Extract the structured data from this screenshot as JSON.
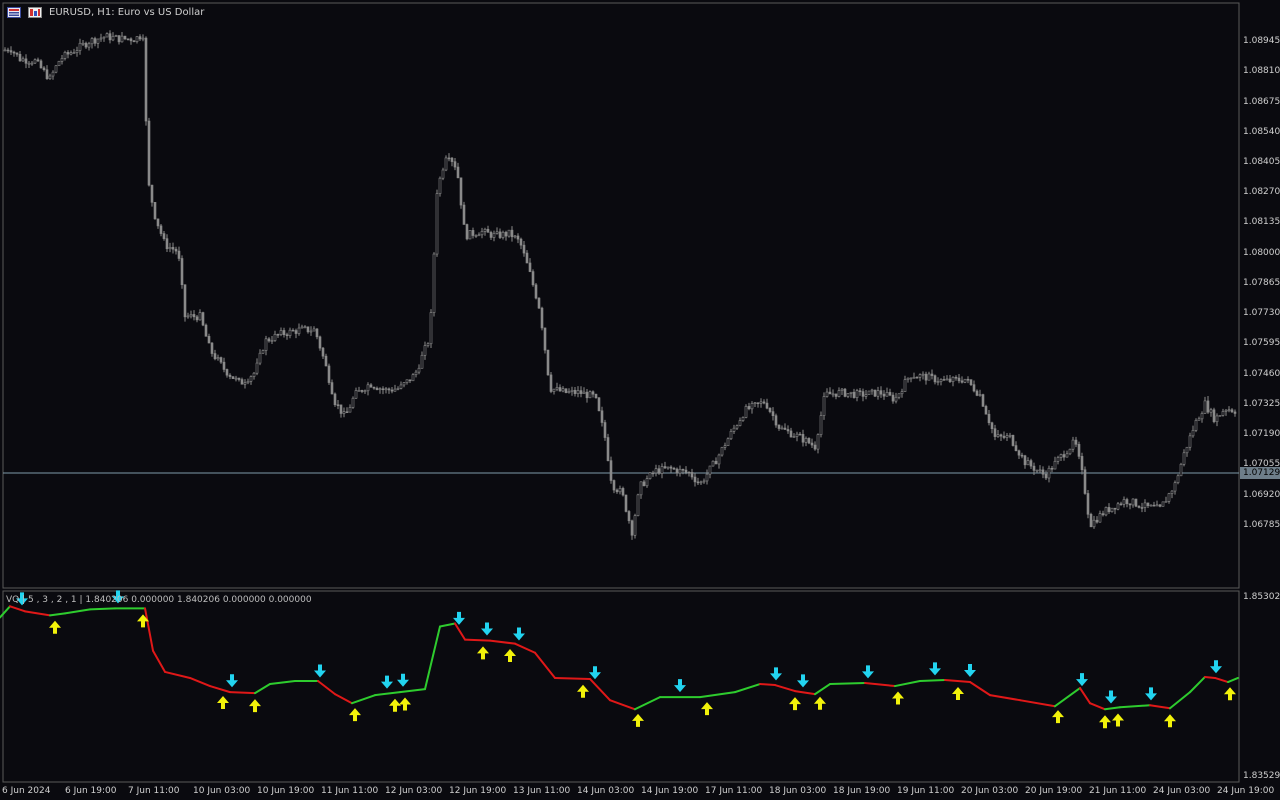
{
  "header": {
    "symbol_title": "EURUSD, H1:  Euro vs US Dollar",
    "icon_1": "chart-grid-icon",
    "icon_2": "bars-icon"
  },
  "indicator": {
    "label": "VQ | 5 , 3 , 2 , 1  |  1.840206 0.000000 1.840206 0.000000 0.000000",
    "scale_top": "1.853022",
    "scale_bottom": "1.835290"
  },
  "price_axis": {
    "labels": [
      "1.08945",
      "1.08810",
      "1.08675",
      "1.08540",
      "1.08405",
      "1.08270",
      "1.08135",
      "1.08000",
      "1.07865",
      "1.07730",
      "1.07595",
      "1.07460",
      "1.07325",
      "1.07190",
      "1.07055",
      "1.06920",
      "1.06785"
    ],
    "current_price": "1.07129"
  },
  "time_axis": {
    "labels": [
      "6 Jun 2024",
      "6 Jun 19:00",
      "7 Jun 11:00",
      "10 Jun 03:00",
      "10 Jun 19:00",
      "11 Jun 11:00",
      "12 Jun 03:00",
      "12 Jun 19:00",
      "13 Jun 11:00",
      "14 Jun 03:00",
      "14 Jun 19:00",
      "17 Jun 11:00",
      "18 Jun 03:00",
      "18 Jun 19:00",
      "19 Jun 11:00",
      "20 Jun 03:00",
      "20 Jun 19:00",
      "21 Jun 11:00",
      "24 Jun 03:00",
      "24 Jun 19:00"
    ]
  },
  "colors": {
    "background": "#0a0a0f",
    "candle": "#8a8a8a",
    "border": "#5a5a5a",
    "current_line": "#7f9aa8",
    "line_up": "#2ecc2e",
    "line_down": "#e01818",
    "arrow_up": "#f2f20a",
    "arrow_down": "#22d4f0"
  },
  "chart_data": {
    "type": "candlestick",
    "symbol": "EURUSD",
    "timeframe": "H1",
    "ylim": [
      1.0665,
      1.0899
    ],
    "current_price": 1.07129,
    "close_path": [
      {
        "x": 0,
        "y": 1.089
      },
      {
        "x": 10,
        "y": 1.0892
      },
      {
        "x": 20,
        "y": 1.0887
      },
      {
        "x": 35,
        "y": 1.0886
      },
      {
        "x": 50,
        "y": 1.0878
      },
      {
        "x": 60,
        "y": 1.0887
      },
      {
        "x": 75,
        "y": 1.0891
      },
      {
        "x": 90,
        "y": 1.0895
      },
      {
        "x": 105,
        "y": 1.0897
      },
      {
        "x": 120,
        "y": 1.0896
      },
      {
        "x": 135,
        "y": 1.0896
      },
      {
        "x": 143,
        "y": 1.0898
      },
      {
        "x": 148,
        "y": 1.0832
      },
      {
        "x": 155,
        "y": 1.0817
      },
      {
        "x": 165,
        "y": 1.0804
      },
      {
        "x": 178,
        "y": 1.0801
      },
      {
        "x": 185,
        "y": 1.0772
      },
      {
        "x": 200,
        "y": 1.0772
      },
      {
        "x": 210,
        "y": 1.0757
      },
      {
        "x": 225,
        "y": 1.0748
      },
      {
        "x": 240,
        "y": 1.0742
      },
      {
        "x": 255,
        "y": 1.0747
      },
      {
        "x": 265,
        "y": 1.0761
      },
      {
        "x": 280,
        "y": 1.0764
      },
      {
        "x": 300,
        "y": 1.0766
      },
      {
        "x": 315,
        "y": 1.0766
      },
      {
        "x": 325,
        "y": 1.0751
      },
      {
        "x": 335,
        "y": 1.0734
      },
      {
        "x": 345,
        "y": 1.0727
      },
      {
        "x": 355,
        "y": 1.0737
      },
      {
        "x": 370,
        "y": 1.0742
      },
      {
        "x": 385,
        "y": 1.0739
      },
      {
        "x": 400,
        "y": 1.074
      },
      {
        "x": 415,
        "y": 1.0746
      },
      {
        "x": 430,
        "y": 1.0763
      },
      {
        "x": 437,
        "y": 1.0828
      },
      {
        "x": 447,
        "y": 1.0846
      },
      {
        "x": 457,
        "y": 1.0838
      },
      {
        "x": 465,
        "y": 1.0808
      },
      {
        "x": 480,
        "y": 1.081
      },
      {
        "x": 495,
        "y": 1.0808
      },
      {
        "x": 510,
        "y": 1.0809
      },
      {
        "x": 520,
        "y": 1.0805
      },
      {
        "x": 530,
        "y": 1.0791
      },
      {
        "x": 540,
        "y": 1.0775
      },
      {
        "x": 550,
        "y": 1.074
      },
      {
        "x": 565,
        "y": 1.0738
      },
      {
        "x": 580,
        "y": 1.0738
      },
      {
        "x": 595,
        "y": 1.0736
      },
      {
        "x": 605,
        "y": 1.0718
      },
      {
        "x": 612,
        "y": 1.0697
      },
      {
        "x": 622,
        "y": 1.0693
      },
      {
        "x": 632,
        "y": 1.0676
      },
      {
        "x": 640,
        "y": 1.0696
      },
      {
        "x": 655,
        "y": 1.0703
      },
      {
        "x": 670,
        "y": 1.0704
      },
      {
        "x": 690,
        "y": 1.0702
      },
      {
        "x": 700,
        "y": 1.0697
      },
      {
        "x": 715,
        "y": 1.0707
      },
      {
        "x": 730,
        "y": 1.0719
      },
      {
        "x": 745,
        "y": 1.073
      },
      {
        "x": 765,
        "y": 1.0734
      },
      {
        "x": 780,
        "y": 1.0722
      },
      {
        "x": 800,
        "y": 1.0718
      },
      {
        "x": 815,
        "y": 1.0714
      },
      {
        "x": 825,
        "y": 1.0737
      },
      {
        "x": 840,
        "y": 1.0738
      },
      {
        "x": 860,
        "y": 1.0737
      },
      {
        "x": 880,
        "y": 1.0738
      },
      {
        "x": 895,
        "y": 1.0735
      },
      {
        "x": 910,
        "y": 1.0746
      },
      {
        "x": 925,
        "y": 1.0745
      },
      {
        "x": 945,
        "y": 1.0743
      },
      {
        "x": 965,
        "y": 1.0744
      },
      {
        "x": 980,
        "y": 1.0737
      },
      {
        "x": 995,
        "y": 1.0718
      },
      {
        "x": 1010,
        "y": 1.0718
      },
      {
        "x": 1025,
        "y": 1.0707
      },
      {
        "x": 1045,
        "y": 1.0701
      },
      {
        "x": 1060,
        "y": 1.0709
      },
      {
        "x": 1075,
        "y": 1.0716
      },
      {
        "x": 1083,
        "y": 1.07
      },
      {
        "x": 1090,
        "y": 1.0679
      },
      {
        "x": 1105,
        "y": 1.0685
      },
      {
        "x": 1125,
        "y": 1.069
      },
      {
        "x": 1145,
        "y": 1.0687
      },
      {
        "x": 1160,
        "y": 1.0686
      },
      {
        "x": 1175,
        "y": 1.0697
      },
      {
        "x": 1185,
        "y": 1.0712
      },
      {
        "x": 1195,
        "y": 1.0724
      },
      {
        "x": 1205,
        "y": 1.0733
      },
      {
        "x": 1215,
        "y": 1.0726
      },
      {
        "x": 1225,
        "y": 1.0731
      },
      {
        "x": 1235,
        "y": 1.073
      }
    ],
    "indicator": {
      "name": "VQ",
      "params": "5,3,2,1",
      "ylim": [
        1.83529,
        1.853022
      ],
      "series": [
        {
          "x": 0,
          "y": 1.851
        },
        {
          "x": 10,
          "y": 1.8521
        },
        {
          "x": 25,
          "y": 1.8516
        },
        {
          "x": 50,
          "y": 1.8512
        },
        {
          "x": 65,
          "y": 1.8514
        },
        {
          "x": 90,
          "y": 1.8518
        },
        {
          "x": 115,
          "y": 1.8519
        },
        {
          "x": 145,
          "y": 1.8519
        },
        {
          "x": 153,
          "y": 1.8477
        },
        {
          "x": 165,
          "y": 1.8456
        },
        {
          "x": 190,
          "y": 1.845
        },
        {
          "x": 210,
          "y": 1.8442
        },
        {
          "x": 230,
          "y": 1.8436
        },
        {
          "x": 255,
          "y": 1.8435
        },
        {
          "x": 270,
          "y": 1.8444
        },
        {
          "x": 295,
          "y": 1.8447
        },
        {
          "x": 318,
          "y": 1.8447
        },
        {
          "x": 335,
          "y": 1.8434
        },
        {
          "x": 352,
          "y": 1.8425
        },
        {
          "x": 375,
          "y": 1.8433
        },
        {
          "x": 400,
          "y": 1.8436
        },
        {
          "x": 425,
          "y": 1.8439
        },
        {
          "x": 440,
          "y": 1.8501
        },
        {
          "x": 455,
          "y": 1.8504
        },
        {
          "x": 465,
          "y": 1.8488
        },
        {
          "x": 490,
          "y": 1.8487
        },
        {
          "x": 515,
          "y": 1.8484
        },
        {
          "x": 535,
          "y": 1.8475
        },
        {
          "x": 555,
          "y": 1.845
        },
        {
          "x": 590,
          "y": 1.8449
        },
        {
          "x": 610,
          "y": 1.8428
        },
        {
          "x": 635,
          "y": 1.8419
        },
        {
          "x": 660,
          "y": 1.8431
        },
        {
          "x": 700,
          "y": 1.8431
        },
        {
          "x": 735,
          "y": 1.8436
        },
        {
          "x": 760,
          "y": 1.8444
        },
        {
          "x": 775,
          "y": 1.8443
        },
        {
          "x": 795,
          "y": 1.8437
        },
        {
          "x": 815,
          "y": 1.8434
        },
        {
          "x": 830,
          "y": 1.8444
        },
        {
          "x": 865,
          "y": 1.8445
        },
        {
          "x": 895,
          "y": 1.8442
        },
        {
          "x": 920,
          "y": 1.8447
        },
        {
          "x": 945,
          "y": 1.8448
        },
        {
          "x": 970,
          "y": 1.8446
        },
        {
          "x": 990,
          "y": 1.8433
        },
        {
          "x": 1020,
          "y": 1.8428
        },
        {
          "x": 1055,
          "y": 1.8422
        },
        {
          "x": 1080,
          "y": 1.844
        },
        {
          "x": 1090,
          "y": 1.8425
        },
        {
          "x": 1105,
          "y": 1.8419
        },
        {
          "x": 1120,
          "y": 1.8421
        },
        {
          "x": 1150,
          "y": 1.8423
        },
        {
          "x": 1170,
          "y": 1.842
        },
        {
          "x": 1190,
          "y": 1.8436
        },
        {
          "x": 1205,
          "y": 1.8451
        },
        {
          "x": 1215,
          "y": 1.845
        },
        {
          "x": 1228,
          "y": 1.8446
        },
        {
          "x": 1238,
          "y": 1.845
        }
      ],
      "arrows_up": [
        55,
        143,
        223,
        255,
        355,
        395,
        405,
        483,
        510,
        583,
        638,
        707,
        795,
        820,
        898,
        958,
        1058,
        1105,
        1118,
        1170,
        1230
      ],
      "arrows_down": [
        22,
        118,
        232,
        320,
        387,
        403,
        459,
        487,
        519,
        595,
        680,
        776,
        803,
        868,
        935,
        970,
        1082,
        1111,
        1151,
        1216
      ]
    }
  }
}
